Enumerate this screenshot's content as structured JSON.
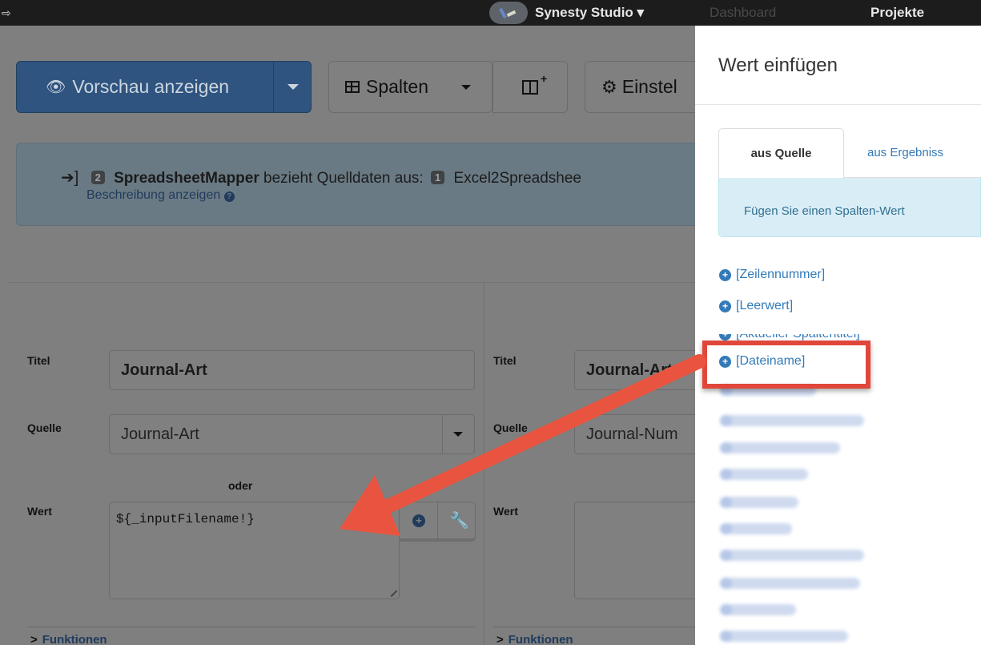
{
  "navbar": {
    "brand": "Synesty Studio",
    "links": [
      "Dashboard",
      "Projekte"
    ]
  },
  "toolbar": {
    "preview_label": "Vorschau anzeigen",
    "columns_label": "Spalten",
    "settings_label": "Einstel"
  },
  "info": {
    "step_badge": "2",
    "step_name": "SpreadsheetMapper",
    "text": "bezieht Quelldaten aus:",
    "source_badge": "1",
    "source_name": "Excel2Spreadshee",
    "description_link": "Beschreibung anzeigen"
  },
  "form": {
    "left": {
      "title_label": "Titel",
      "title_value": "Journal-Art",
      "source_label": "Quelle",
      "source_value": "Journal-Art",
      "or_label": "oder",
      "value_label": "Wert",
      "value_text": "${_inputFilename!}",
      "functions_link": "Funktionen"
    },
    "right": {
      "title_label": "Titel",
      "title_value": "Journal-Art",
      "source_label": "Quelle",
      "source_value": "Journal-Num",
      "value_label": "Wert",
      "functions_link": "Funktionen"
    }
  },
  "modal": {
    "title": "Wert einfügen",
    "tabs": [
      "aus Quelle",
      "aus Ergebniss"
    ],
    "info_text": "Fügen Sie einen Spalten-Wert",
    "options": [
      "[Zeilennummer]",
      "[Leerwert]",
      "[Aktueller Spaltentitel]",
      "[Dateiname]"
    ]
  },
  "colors": {
    "accent": "#337ab7",
    "highlight": "#e0473a",
    "info_bg": "#d9edf7"
  }
}
